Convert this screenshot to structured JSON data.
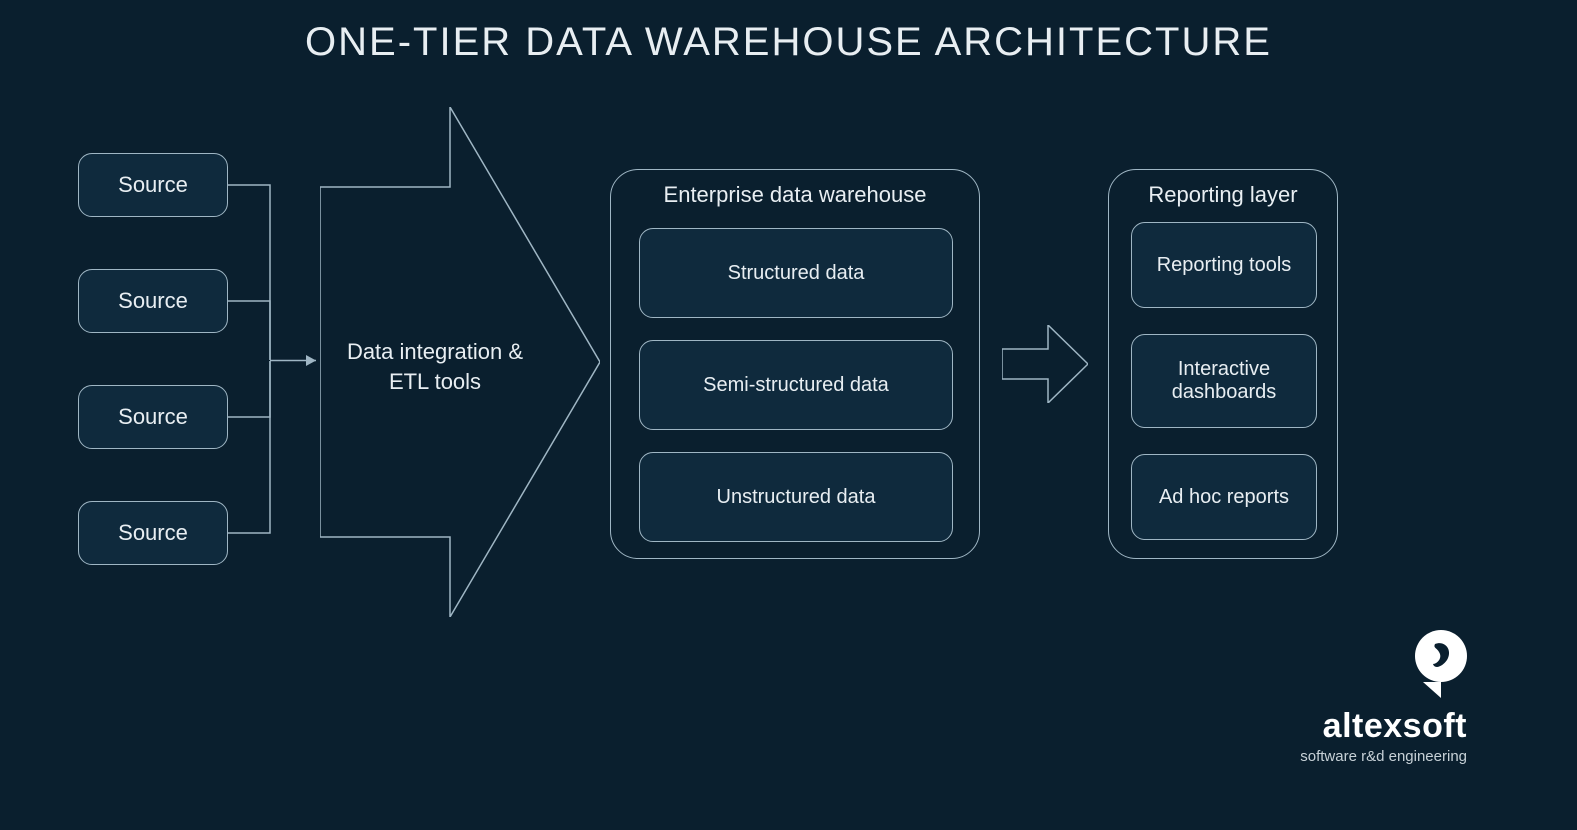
{
  "title": "ONE-TIER DATA WAREHOUSE ARCHITECTURE",
  "sources": [
    "Source",
    "Source",
    "Source",
    "Source"
  ],
  "etl_label_line1": "Data integration &",
  "etl_label_line2": "ETL tools",
  "warehouse": {
    "title": "Enterprise data warehouse",
    "items": [
      "Structured data",
      "Semi-structured data",
      "Unstructured data"
    ]
  },
  "reporting": {
    "title": "Reporting layer",
    "items": [
      "Reporting tools",
      "Interactive dashboards",
      "Ad hoc reports"
    ]
  },
  "brand": {
    "name": "altexsoft",
    "tagline": "software r&d engineering"
  }
}
